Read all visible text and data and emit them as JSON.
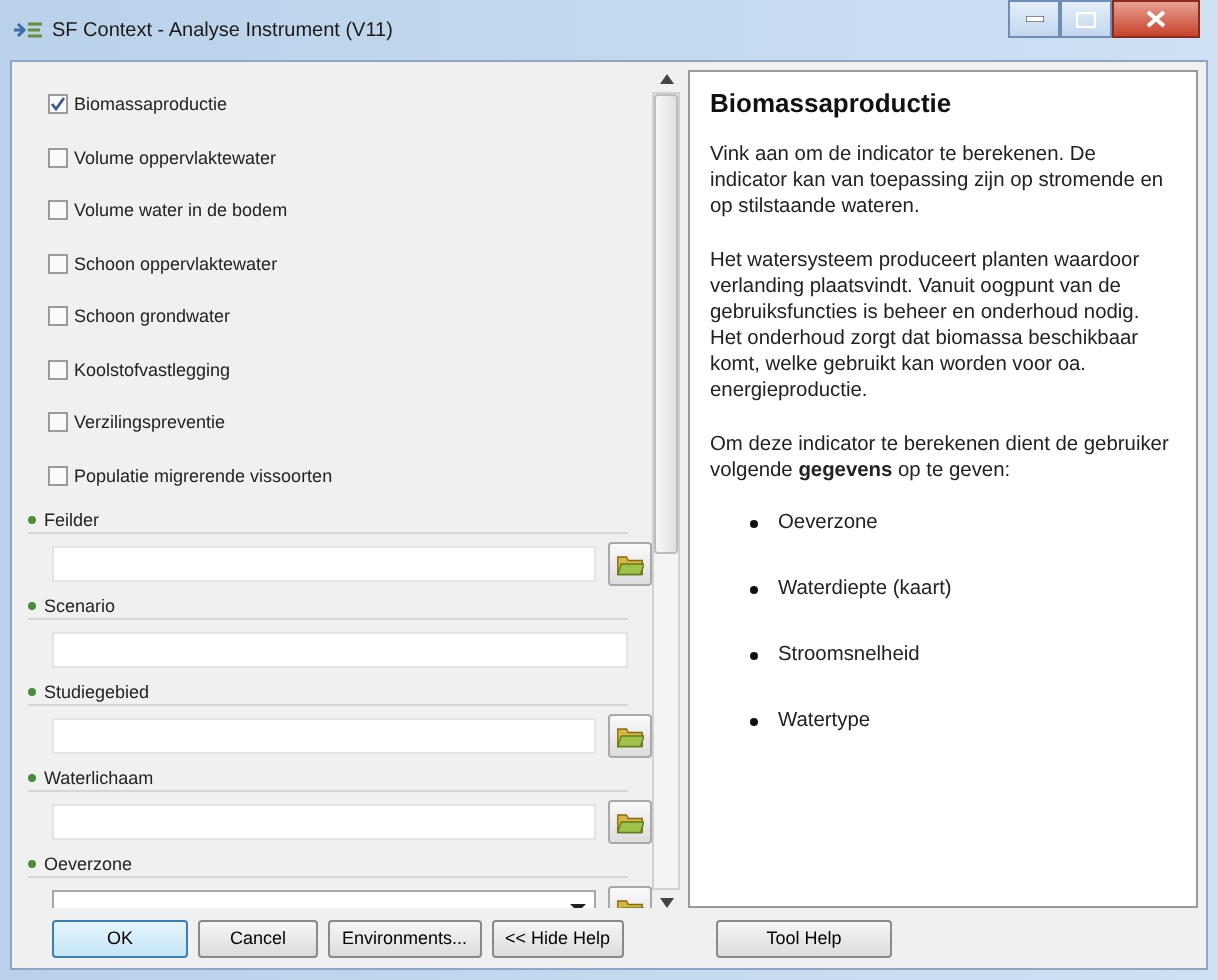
{
  "window": {
    "title": "SF Context - Analyse Instrument (V11)"
  },
  "indicators": [
    {
      "label": "Biomassaproductie",
      "checked": true
    },
    {
      "label": "Volume oppervlaktewater",
      "checked": false
    },
    {
      "label": "Volume water in de bodem",
      "checked": false
    },
    {
      "label": "Schoon oppervlaktewater",
      "checked": false
    },
    {
      "label": "Schoon grondwater",
      "checked": false
    },
    {
      "label": "Koolstofvastlegging",
      "checked": false
    },
    {
      "label": "Verzilingspreventie",
      "checked": false
    },
    {
      "label": "Populatie migrerende vissoorten",
      "checked": false
    }
  ],
  "parameters": [
    {
      "label": "Feilder",
      "kind": "browse"
    },
    {
      "label": "Scenario",
      "kind": "text"
    },
    {
      "label": "Studiegebied",
      "kind": "browse"
    },
    {
      "label": "Waterlichaam",
      "kind": "browse"
    },
    {
      "label": "Oeverzone",
      "kind": "combo"
    }
  ],
  "help": {
    "title": "Biomassaproductie",
    "paragraphs": [
      "Vink aan om de indicator te berekenen. De indicator kan van toepassing zijn op stromende en op stilstaande wateren.",
      "Het watersysteem produceert planten waardoor verlanding plaatsvindt. Vanuit oogpunt van de gebruiksfuncties is beheer en onderhoud nodig. Het onderhoud zorgt dat biomassa beschikbaar komt, welke gebruikt kan worden voor oa. energieproductie.",
      "Om deze indicator te berekenen dient de gebruiker volgende **gegevens** op te geven:"
    ],
    "bullets": [
      "Oeverzone",
      "Waterdiepte (kaart)",
      "Stroomsnelheid",
      "Watertype"
    ]
  },
  "buttons": [
    "OK",
    "Cancel",
    "Environments...",
    "<< Hide Help"
  ],
  "help_button": "Tool Help"
}
